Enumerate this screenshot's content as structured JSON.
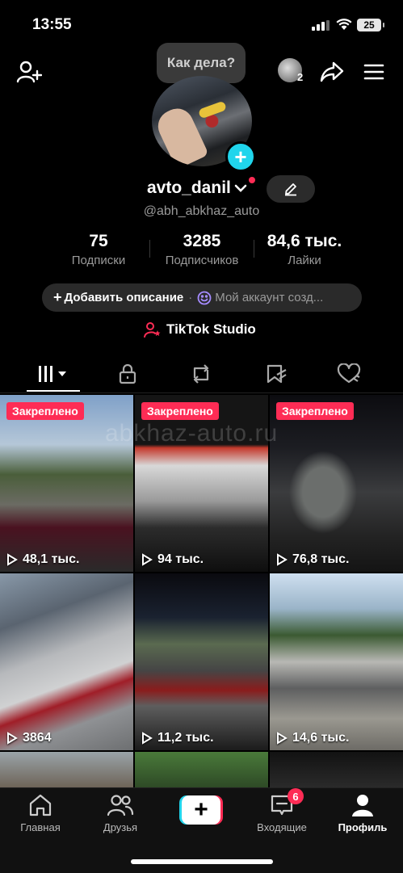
{
  "status_bar": {
    "time": "13:55",
    "battery": "25"
  },
  "header": {
    "bubble_text": "Как дела?",
    "friends_count": "2"
  },
  "profile": {
    "username": "avto_danil",
    "handle": "@abh_abkhaz_auto",
    "stats": [
      {
        "value": "75",
        "label": "Подписки"
      },
      {
        "value": "3285",
        "label": "Подписчиков"
      },
      {
        "value": "84,6 тыс.",
        "label": "Лайки"
      }
    ],
    "description_add": "Добавить описание",
    "description_dot": "·",
    "description_placeholder": "Мой аккаунт созд...",
    "studio_label": "TikTok Studio"
  },
  "videos": [
    {
      "pinned": "Закреплено",
      "views": "48,1 тыс."
    },
    {
      "pinned": "Закреплено",
      "views": "94 тыс."
    },
    {
      "pinned": "Закреплено",
      "views": "76,8 тыс."
    },
    {
      "pinned": "",
      "views": "3864"
    },
    {
      "pinned": "",
      "views": "11,2 тыс."
    },
    {
      "pinned": "",
      "views": "14,6 тыс."
    }
  ],
  "watermark": "abkhaz-auto.ru",
  "nav": {
    "home": "Главная",
    "friends": "Друзья",
    "inbox": "Входящие",
    "inbox_badge": "6",
    "profile": "Профиль"
  },
  "colors": {
    "accent_red": "#fe2c55",
    "accent_cyan": "#20d5ec",
    "background": "#000000"
  }
}
